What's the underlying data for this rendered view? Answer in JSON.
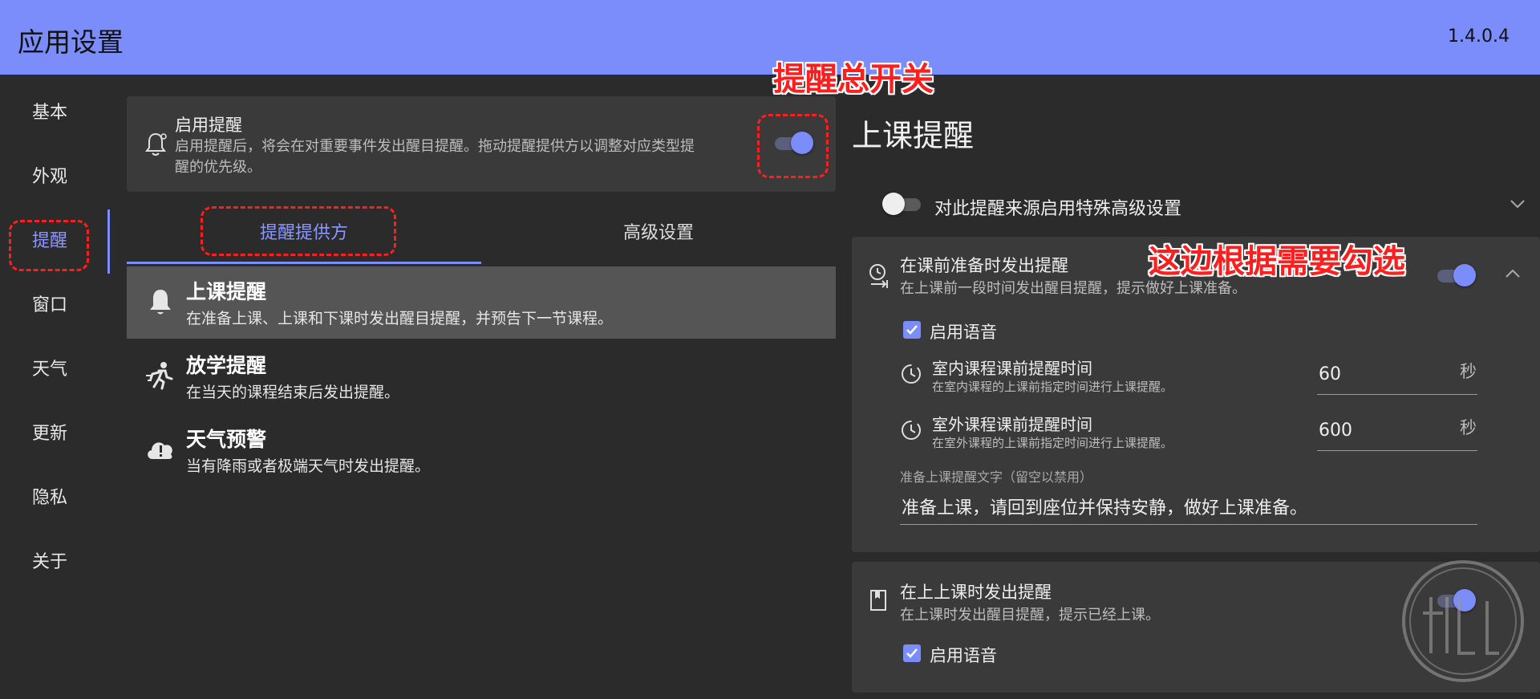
{
  "header": {
    "title": "应用设置",
    "version": "1.4.0.4"
  },
  "sidebar": {
    "items": [
      {
        "label": "基本"
      },
      {
        "label": "外观"
      },
      {
        "label": "提醒"
      },
      {
        "label": "窗口"
      },
      {
        "label": "天气"
      },
      {
        "label": "更新"
      },
      {
        "label": "隐私"
      },
      {
        "label": "关于"
      }
    ],
    "active_index": 2
  },
  "enable_card": {
    "title": "启用提醒",
    "desc_line1": "启用提醒后，将会在对重要事件发出醒目提醒。拖动提醒提供方以调整对应类型提",
    "desc_line2": "醒的优先级。",
    "icon": "bell-settings-icon",
    "toggle_on": true
  },
  "tabs": [
    {
      "label": "提醒提供方",
      "active": true
    },
    {
      "label": "高级设置",
      "active": false
    }
  ],
  "providers": [
    {
      "title": "上课提醒",
      "desc": "在准备上课、上课和下课时发出醒目提醒，并预告下一节课程。",
      "icon": "bell-icon"
    },
    {
      "title": "放学提醒",
      "desc": "在当天的课程结束后发出提醒。",
      "icon": "running-person-icon"
    },
    {
      "title": "天气预警",
      "desc": "当有降雨或者极端天气时发出提醒。",
      "icon": "cloud-alert-icon"
    }
  ],
  "detail": {
    "title": "上课提醒",
    "advanced_toggle_label": "对此提醒来源启用特殊高级设置",
    "before_class": {
      "title": "在课前准备时发出提醒",
      "desc": "在上课前一段时间发出醒目提醒，提示做好上课准备。",
      "voice_label": "启用语音",
      "indoor": {
        "title": "室内课程课前提醒时间",
        "desc": "在室内课程的上课前指定时间进行上课提醒。",
        "value": "60",
        "unit": "秒"
      },
      "outdoor": {
        "title": "室外课程课前提醒时间",
        "desc": "在室外课程的上课前指定时间进行上课提醒。",
        "value": "600",
        "unit": "秒"
      },
      "text_label": "准备上课提醒文字（留空以禁用）",
      "text_value": "准备上课，请回到座位并保持安静，做好上课准备。"
    },
    "on_class": {
      "title": "在上上课时发出提醒",
      "desc": "在上课时发出醒目提醒，提示已经上课。",
      "voice_label": "启用语音"
    }
  },
  "annotations": {
    "master_switch": "提醒总开关",
    "check_as_needed": "这边根据需要勾选"
  },
  "colors": {
    "accent": "#7b8cfb",
    "header_bg": "#7b8cfb",
    "annotation": "#ff1e1e",
    "background": "#2b2b2b",
    "card": "#3a3a3a"
  }
}
